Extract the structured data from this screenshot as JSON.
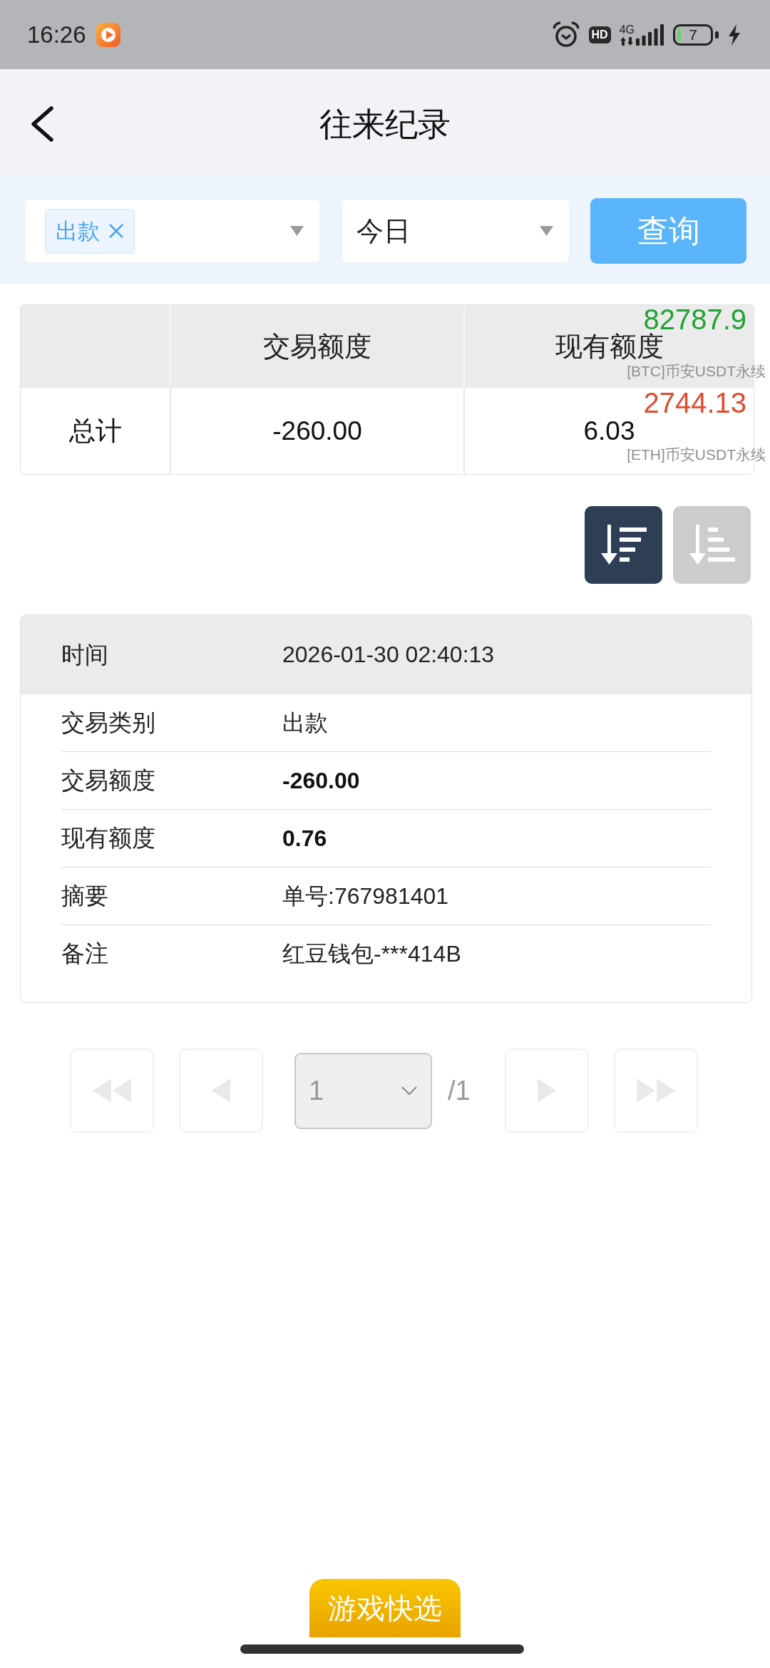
{
  "status_bar": {
    "time": "16:26",
    "hd": "HD",
    "network": "4G",
    "battery": "7"
  },
  "header": {
    "title": "往来纪录"
  },
  "filters": {
    "type_tags": [
      "出款"
    ],
    "date": "今日",
    "query_button": "查询"
  },
  "summary_table": {
    "columns": [
      "交易额度",
      "现有额度"
    ],
    "rows": [
      {
        "label": "总计",
        "cells": [
          "-260.00",
          "6.03"
        ]
      }
    ]
  },
  "ticker": [
    {
      "price": "82787.9",
      "color": "#1ea332",
      "label": "[BTC]币安USDT永续"
    },
    {
      "price": "2744.13",
      "color": "#e04a2f",
      "label": "[ETH]币安USDT永续"
    }
  ],
  "sort_buttons": [
    {
      "kind": "descending",
      "selected": true
    },
    {
      "kind": "ascending",
      "selected": false
    }
  ],
  "record": {
    "header": {
      "label": "时间",
      "value": "2026-01-30 02:40:13"
    },
    "rows": [
      {
        "label": "交易类别",
        "value": "出款",
        "kind": "text"
      },
      {
        "label": "交易额度",
        "value": "-260.00",
        "kind": "amount"
      },
      {
        "label": "现有额度",
        "value": "0.76",
        "kind": "amount"
      },
      {
        "label": "摘要",
        "value": "单号:767981401",
        "kind": "text"
      },
      {
        "label": "备注",
        "value": "红豆钱包-***414B",
        "kind": "text"
      }
    ]
  },
  "pagination": {
    "buttons": [
      {
        "kind": "first",
        "disabled": true
      },
      {
        "kind": "previous",
        "disabled": true
      },
      {
        "kind": "next",
        "disabled": true
      },
      {
        "kind": "last",
        "disabled": true
      }
    ],
    "page": "1",
    "total": "/1"
  },
  "floating_button": "游戏快选"
}
